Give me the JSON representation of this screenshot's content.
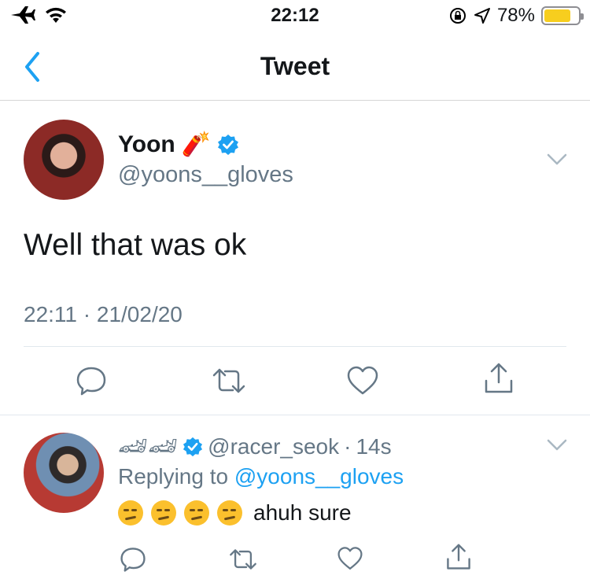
{
  "status_bar": {
    "time": "22:12",
    "battery_percent": "78%",
    "battery_level": 0.78,
    "icons": [
      "airplane-icon",
      "wifi-icon",
      "rotation-lock-icon",
      "location-icon",
      "battery-icon"
    ]
  },
  "nav": {
    "title": "Tweet"
  },
  "tweet": {
    "author_name": "Yoon",
    "author_emoji": "🧨",
    "handle": "@yoons__gloves",
    "text": "Well that was ok",
    "timestamp": "22:11 · 21/02/20"
  },
  "reply": {
    "name_emoji": "🏎🏎",
    "handle": "@racer_seok",
    "separator": "·",
    "age": "14s",
    "replying_label": "Replying to",
    "replying_handle": "@yoons__gloves",
    "text": "ahuh sure"
  },
  "colors": {
    "accent": "#1da1f2",
    "secondary_text": "#657786",
    "divider": "#e1e8ed",
    "battery": "#f7ce1e"
  }
}
